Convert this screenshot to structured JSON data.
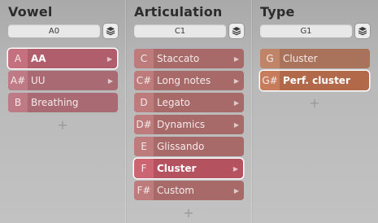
{
  "columns": [
    {
      "title": "Vowel",
      "key_value": "A0",
      "items": [
        {
          "key": "A",
          "label": "AA",
          "selected": true,
          "arrow": true
        },
        {
          "key": "A#",
          "label": "UU",
          "selected": false,
          "arrow": true
        },
        {
          "key": "B",
          "label": "Breathing",
          "selected": false,
          "arrow": false
        }
      ]
    },
    {
      "title": "Articulation",
      "key_value": "C1",
      "items": [
        {
          "key": "C",
          "label": "Staccato",
          "selected": false,
          "arrow": true
        },
        {
          "key": "C#",
          "label": "Long notes",
          "selected": false,
          "arrow": true
        },
        {
          "key": "D",
          "label": "Legato",
          "selected": false,
          "arrow": true
        },
        {
          "key": "D#",
          "label": "Dynamics",
          "selected": false,
          "arrow": true
        },
        {
          "key": "E",
          "label": "Glissando",
          "selected": false,
          "arrow": false
        },
        {
          "key": "F",
          "label": "Cluster",
          "selected": true,
          "arrow": true
        },
        {
          "key": "F#",
          "label": "Custom",
          "selected": false,
          "arrow": true
        }
      ]
    },
    {
      "title": "Type",
      "key_value": "G1",
      "items": [
        {
          "key": "G",
          "label": "Cluster",
          "selected": false,
          "arrow": false
        },
        {
          "key": "G#",
          "label": "Perf. cluster",
          "selected": true,
          "arrow": false
        }
      ]
    }
  ],
  "icons": {
    "layers": "layers-icon",
    "add": "plus-icon",
    "arrow": "chevron-right-icon"
  },
  "colors": {
    "vowel_item": "#b06a74",
    "vowel_key": "#c97a86",
    "vowel_selected": "#bd5a6e",
    "articulation_item": "#a96a6a",
    "articulation_key": "#c07b7b",
    "articulation_selected": "#b65060",
    "type_item": "#a87258",
    "type_key": "#c28366",
    "type_selected": "#b56a4a"
  }
}
